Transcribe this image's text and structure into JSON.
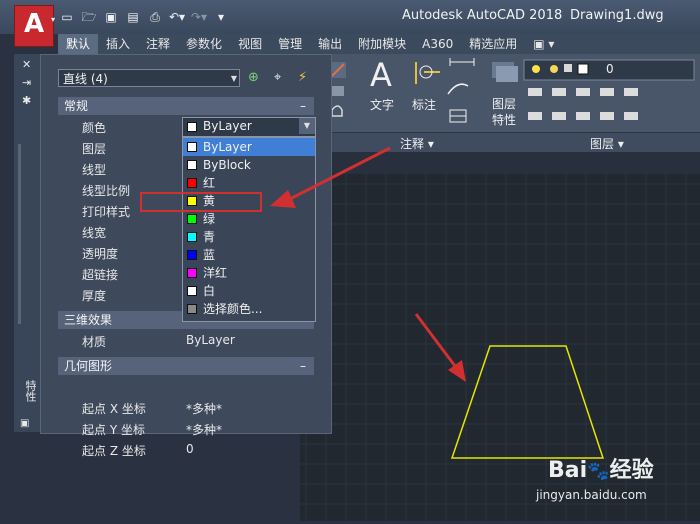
{
  "app_button": {
    "letter": "A"
  },
  "title": {
    "app": "Autodesk AutoCAD 2018",
    "document": "Drawing1.dwg"
  },
  "qat_icons": [
    "new-icon",
    "open-icon",
    "save-icon",
    "saveas-icon",
    "plot-icon",
    "undo-icon",
    "redo-icon",
    "dropdown-icon"
  ],
  "tabs": [
    {
      "label": "默认",
      "active": true
    },
    {
      "label": "插入"
    },
    {
      "label": "注释"
    },
    {
      "label": "参数化"
    },
    {
      "label": "视图"
    },
    {
      "label": "管理"
    },
    {
      "label": "输出"
    },
    {
      "label": "附加模块"
    },
    {
      "label": "A360"
    },
    {
      "label": "精选应用"
    },
    {
      "label": "▣ ▾"
    }
  ],
  "ribbon": {
    "text_label": "文字",
    "dim_label": "标注",
    "annotation_panel": "注释 ▾",
    "layer_props_label": "图层\n特性",
    "layers_panel": "图层 ▾",
    "layer_value": "0",
    "text_glyph": "A"
  },
  "palette": {
    "side_label": "特性",
    "object_selector": "直线 (4)",
    "sections": {
      "general": "常规",
      "effects3d": "三维效果",
      "geometry": "几何图形",
      "collapse": "–"
    },
    "general_rows": [
      {
        "label": "颜色",
        "value": "ByLayer"
      },
      {
        "label": "图层",
        "value": ""
      },
      {
        "label": "线型",
        "value": ""
      },
      {
        "label": "线型比例",
        "value": ""
      },
      {
        "label": "打印样式",
        "value": ""
      },
      {
        "label": "线宽",
        "value": ""
      },
      {
        "label": "透明度",
        "value": ""
      },
      {
        "label": "超链接",
        "value": ""
      },
      {
        "label": "厚度",
        "value": ""
      }
    ],
    "effects_rows": [
      {
        "label": "材质",
        "value": "ByLayer"
      }
    ],
    "geometry_rows": [
      {
        "label": "起点 X 坐标",
        "value": "*多种*"
      },
      {
        "label": "起点 Y 坐标",
        "value": "*多种*"
      },
      {
        "label": "起点 Z 坐标",
        "value": "0"
      }
    ]
  },
  "color_dropdown": {
    "items": [
      {
        "label": "ByLayer",
        "swatch": "#ffffff",
        "selected": true
      },
      {
        "label": "ByBlock",
        "swatch": "#ffffff"
      },
      {
        "label": "红",
        "swatch": "#ff0000"
      },
      {
        "label": "黄",
        "swatch": "#ffff00"
      },
      {
        "label": "绿",
        "swatch": "#00ff00"
      },
      {
        "label": "青",
        "swatch": "#00ffff"
      },
      {
        "label": "蓝",
        "swatch": "#0000ff"
      },
      {
        "label": "洋红",
        "swatch": "#ff00ff"
      },
      {
        "label": "白",
        "swatch": "#ffffff"
      },
      {
        "label": "选择颜色...",
        "swatch": "#8a8a8a"
      }
    ]
  },
  "watermark": {
    "brand": "Bai",
    "brand2": "经验",
    "url": "jingyan.baidu.com"
  },
  "colors": {
    "accent_blue": "#3f7fd6",
    "annotation_red": "#d23030",
    "drawing_yellow": "#e6e600"
  }
}
